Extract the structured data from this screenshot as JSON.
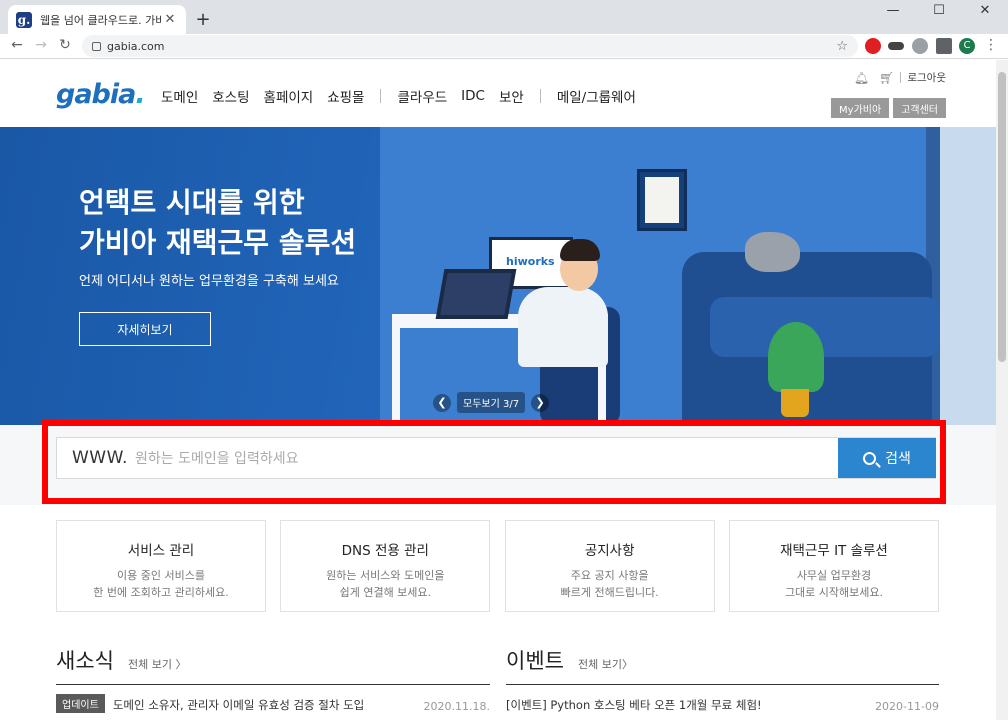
{
  "browser": {
    "tab_title": "웹을 넘어 클라우드로. 가비아",
    "favicon_letter": "g.",
    "url": "gabia.com",
    "profile_initial": "C"
  },
  "header": {
    "logo": "gabia",
    "logo_dot": ".",
    "nav_group1": [
      "도메인",
      "호스팅",
      "홈페이지",
      "쇼핑몰"
    ],
    "nav_group2": [
      "클라우드",
      "IDC",
      "보안"
    ],
    "nav_group3": [
      "메일/그룹웨어"
    ],
    "logout": "로그아웃",
    "my_gabia": "My가비아",
    "support": "고객센터"
  },
  "hero": {
    "title_line1": "언택트 시대를 위한",
    "title_line2": "가비아 재택근무 솔루션",
    "subtitle": "언제 어디서나 원하는 업무환경을 구축해 보세요",
    "cta": "자세히보기",
    "monitor_text": "hiworks",
    "pager_text": "모두보기 3/7"
  },
  "search": {
    "prefix": "WWW.",
    "placeholder": "원하는 도메인을 입력하세요",
    "value": "",
    "button": "검색",
    "highlight_color": "#ff0000"
  },
  "cards": [
    {
      "title": "서비스 관리",
      "desc1": "이용 중인 서비스를",
      "desc2": "한 번에 조회하고 관리하세요."
    },
    {
      "title": "DNS 전용 관리",
      "desc1": "원하는 서비스와 도메인을",
      "desc2": "쉽게 연결해 보세요."
    },
    {
      "title": "공지사항",
      "desc1": "주요 공지 사항을",
      "desc2": "빠르게 전해드립니다."
    },
    {
      "title": "재택근무 IT 솔루션",
      "desc1": "사무실 업무환경",
      "desc2": "그대로 시작해보세요."
    }
  ],
  "news": {
    "title": "새소식",
    "more": "전체 보기 〉",
    "items": [
      {
        "badge": "업데이트",
        "text": "도메인 소유자, 관리자 이메일 유효성 검증 절차 도입",
        "date": "2020.11.18."
      }
    ]
  },
  "events": {
    "title": "이벤트",
    "more": "전체 보기〉",
    "items": [
      {
        "text": "[이벤트] Python 호스팅 베타 오픈 1개월 무료 체험!",
        "date": "2020-11-09"
      }
    ]
  },
  "colors": {
    "brand": "#1e6fbf",
    "search_button": "#2b86cf",
    "hero_bg": "#1a58a6"
  }
}
